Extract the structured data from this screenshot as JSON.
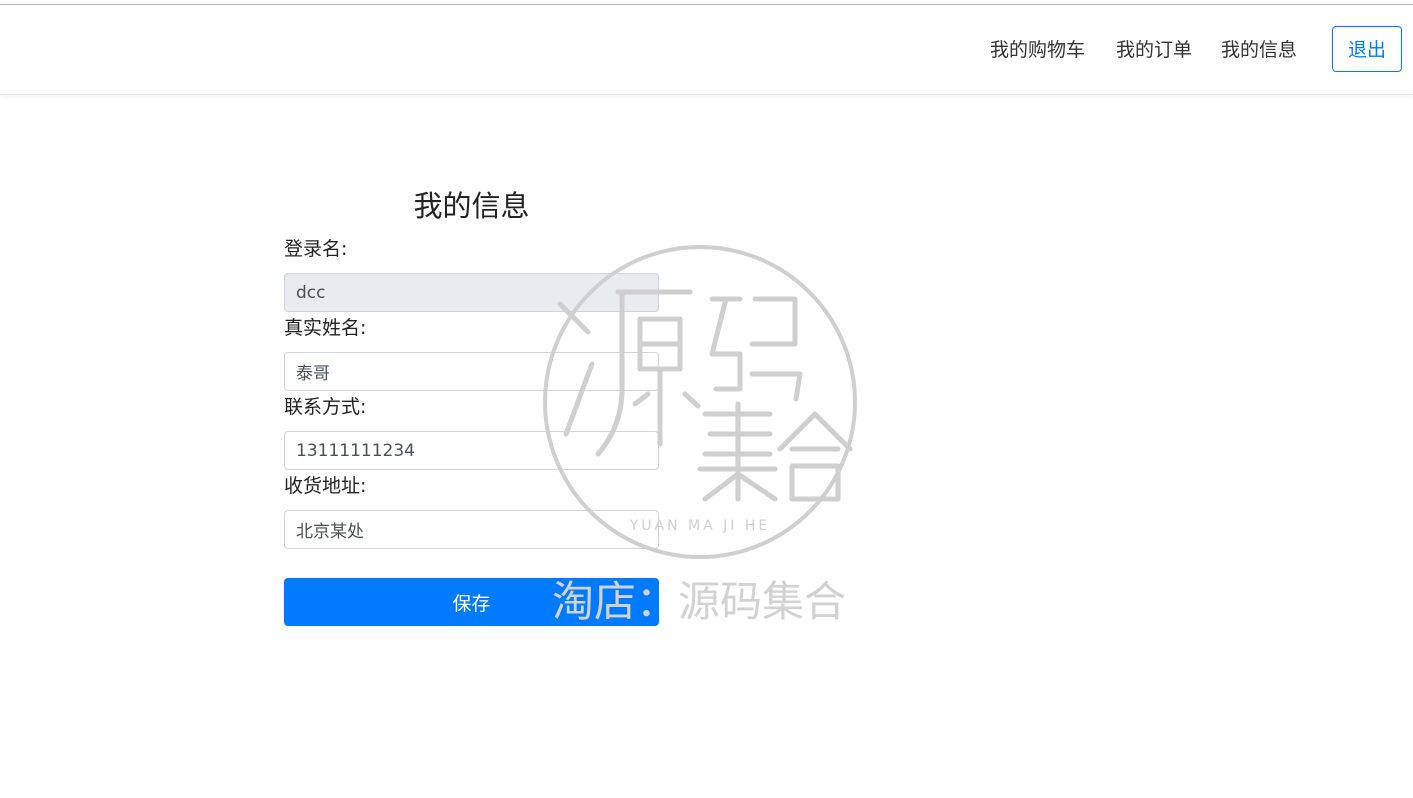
{
  "nav": {
    "items": [
      {
        "label": "我的购物车"
      },
      {
        "label": "我的订单"
      },
      {
        "label": "我的信息"
      }
    ],
    "logout_label": "退出"
  },
  "form": {
    "title": "我的信息",
    "fields": {
      "login_name": {
        "label": "登录名:",
        "value": "dcc"
      },
      "real_name": {
        "label": "真实姓名:",
        "value": "泰哥"
      },
      "contact": {
        "label": "联系方式:",
        "value": "13111111234"
      },
      "address": {
        "label": "收货地址:",
        "value": "北京某处"
      }
    },
    "save_label": "保存"
  },
  "watermark": {
    "seal_text": "源码集合",
    "pinyin": "YUAN MA JI HE",
    "shop_text": "淘店：源码集合"
  },
  "colors": {
    "primary": "#007bff",
    "readonly_bg": "#e9ecef"
  }
}
